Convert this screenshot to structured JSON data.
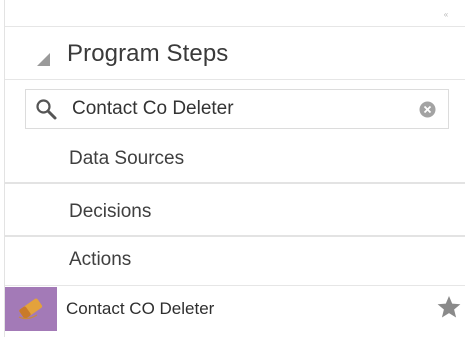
{
  "panel": {
    "title": "Program Steps",
    "collapse_icon": "chevron-collapse-icon",
    "expand_icon": "triangle-expanded-icon"
  },
  "search": {
    "value": "Contact Co Deleter",
    "search_icon": "search-icon",
    "clear_icon": "clear-circle-icon"
  },
  "categories": [
    {
      "label": "Data Sources"
    },
    {
      "label": "Decisions"
    },
    {
      "label": "Actions"
    }
  ],
  "result": {
    "label": "Contact CO Deleter",
    "thumb_icon": "eraser-action-icon",
    "favorite_icon": "star-icon",
    "thumb_color": "#a37ab7"
  }
}
